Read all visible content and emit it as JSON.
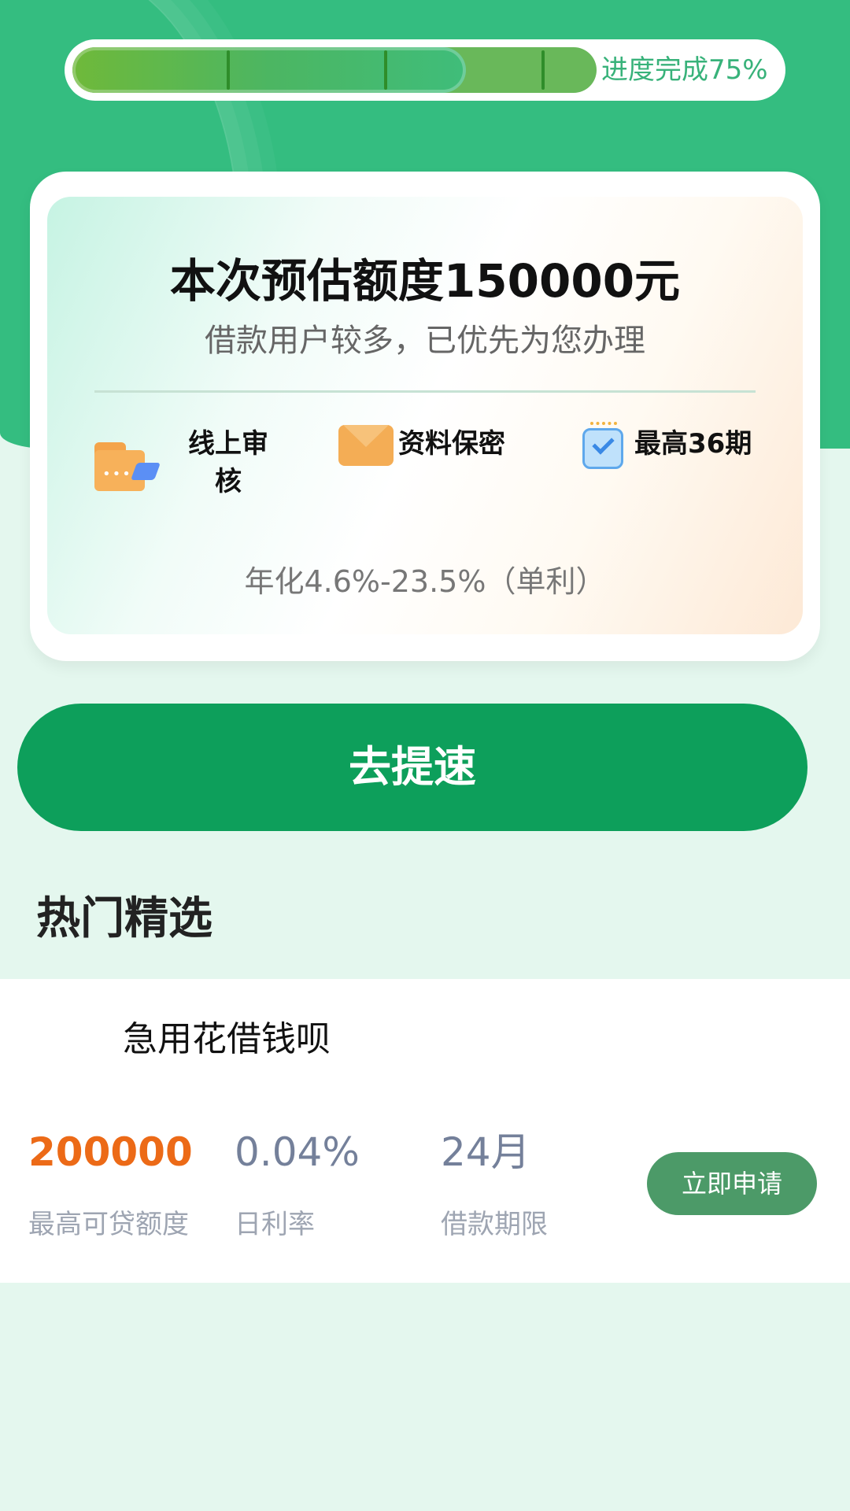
{
  "progress": {
    "label": "进度完成75%",
    "value": 0.75,
    "segments": 4
  },
  "estimate_card": {
    "title": "本次预估额度150000元",
    "subtitle": "借款用户较多，已优先为您办理",
    "features": [
      {
        "icon": "folder-share-icon",
        "label": "线上审核"
      },
      {
        "icon": "envelope-icon",
        "label": "资料保密"
      },
      {
        "icon": "calendar-check-icon",
        "label": "最高36期"
      }
    ],
    "rate_text": "年化4.6%-23.5%（单利）"
  },
  "cta": {
    "label": "去提速"
  },
  "hot_section": {
    "title": "热门精选"
  },
  "product": {
    "name": "急用花借钱呗",
    "stats": [
      {
        "value": "200000",
        "label": "最高可贷额度"
      },
      {
        "value": "0.04%",
        "label": "日利率"
      },
      {
        "value": "24月",
        "label": "借款期限"
      }
    ],
    "apply_label": "立即申请"
  },
  "colors": {
    "header_green": "#34bd80",
    "button_green": "#0d9f5b",
    "highlight_orange": "#ec6a17",
    "apply_green": "#4c9a68",
    "page_bg": "#e4f7ee"
  }
}
